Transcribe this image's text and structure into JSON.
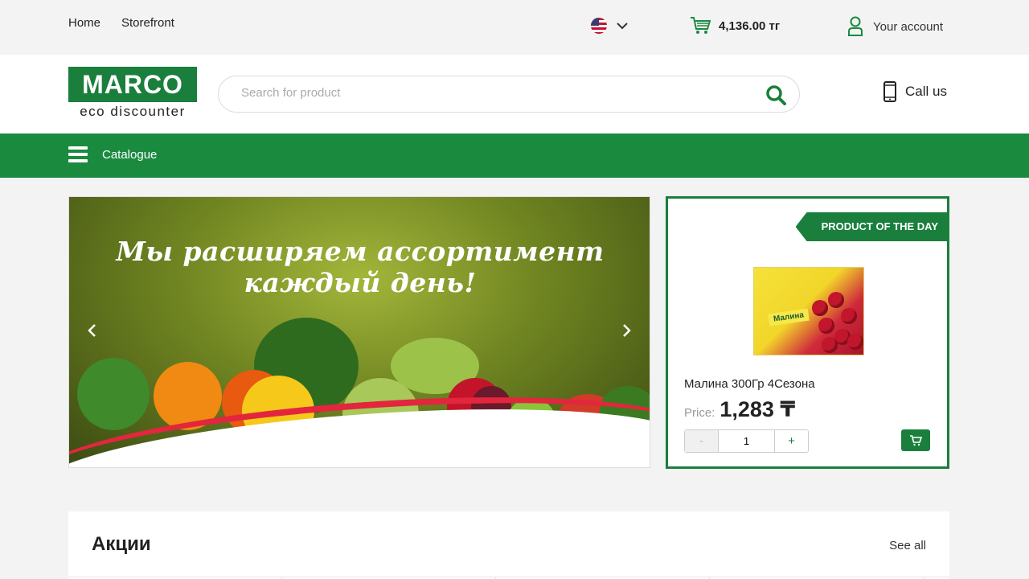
{
  "topbar": {
    "nav": [
      "Home",
      "Storefront"
    ],
    "cart_total": "4,136.00 тг",
    "account_label": "Your account"
  },
  "header": {
    "logo_main": "MARCO",
    "logo_sub": "eco discounter",
    "search_placeholder": "Search for product",
    "call_label": "Call us"
  },
  "catbar": {
    "catalogue_label": "Catalogue"
  },
  "hero": {
    "text": "Мы расширяем ассортимент каждый день!",
    "slide_count": 3,
    "active_slide": 1
  },
  "potd": {
    "badge": "PRODUCT OF THE DAY",
    "image_tag": "Малина",
    "name": "Малина 300Гр 4Сезона",
    "price_label": "Price:",
    "price_value": "1,283 ₸",
    "qty_minus": "-",
    "qty_plus": "+",
    "quantity": "1"
  },
  "promos": {
    "title": "Акции",
    "see_all": "See all"
  },
  "colors": {
    "brand_green": "#1a7f3c",
    "bar_green": "#1a8a3f",
    "accent_red": "#e2263d"
  }
}
